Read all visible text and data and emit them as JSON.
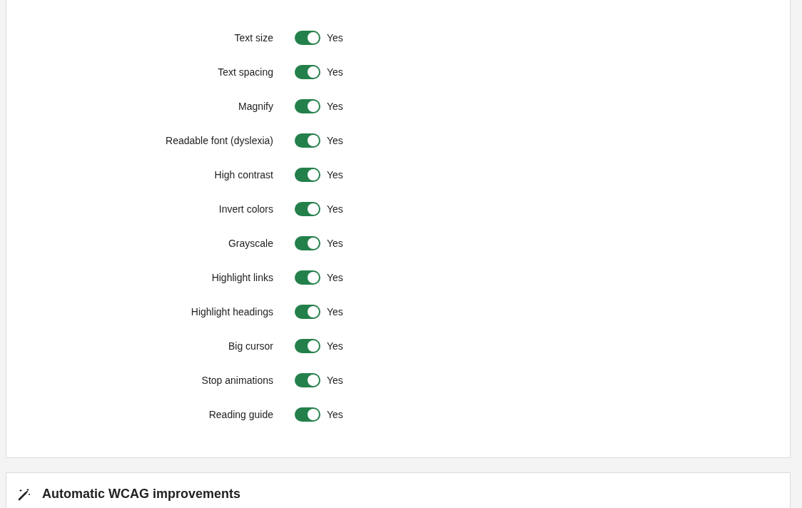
{
  "settings_panel": {
    "items": [
      {
        "label": "Text size",
        "on": true,
        "state_text": "Yes"
      },
      {
        "label": "Text spacing",
        "on": true,
        "state_text": "Yes"
      },
      {
        "label": "Magnify",
        "on": true,
        "state_text": "Yes"
      },
      {
        "label": "Readable font (dyslexia)",
        "on": true,
        "state_text": "Yes"
      },
      {
        "label": "High contrast",
        "on": true,
        "state_text": "Yes"
      },
      {
        "label": "Invert colors",
        "on": true,
        "state_text": "Yes"
      },
      {
        "label": "Grayscale",
        "on": true,
        "state_text": "Yes"
      },
      {
        "label": "Highlight links",
        "on": true,
        "state_text": "Yes"
      },
      {
        "label": "Highlight headings",
        "on": true,
        "state_text": "Yes"
      },
      {
        "label": "Big cursor",
        "on": true,
        "state_text": "Yes"
      },
      {
        "label": "Stop animations",
        "on": true,
        "state_text": "Yes"
      },
      {
        "label": "Reading guide",
        "on": true,
        "state_text": "Yes"
      }
    ]
  },
  "wcag_panel": {
    "title": "Automatic WCAG improvements"
  }
}
